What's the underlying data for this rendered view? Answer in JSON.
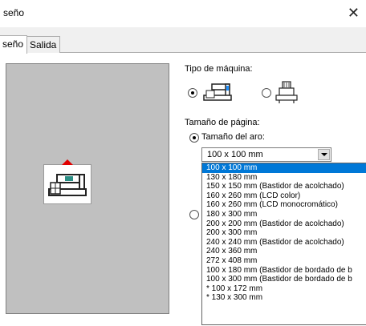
{
  "window": {
    "title": "seño",
    "close_glyph": "✕"
  },
  "tabs": [
    {
      "label": "seño",
      "active": true
    },
    {
      "label": "Salida",
      "active": false
    }
  ],
  "machine": {
    "heading": "Tipo de máquina:",
    "options": [
      {
        "name": "single-needle-machine",
        "selected": true
      },
      {
        "name": "multi-needle-machine",
        "selected": false
      }
    ]
  },
  "page_size": {
    "heading": "Tamaño de página:",
    "hoop_option": {
      "label": "Tamaño del aro:",
      "selected": true
    },
    "second_option": {
      "selected": false
    },
    "combo_value": "100 x 100 mm",
    "dropdown_items": [
      "100 x 100 mm",
      "130 x 180 mm",
      "150 x 150 mm (Bastidor de acolchado)",
      "160 x 260 mm (LCD color)",
      "160 x 260 mm (LCD monocromático)",
      "180 x 300 mm",
      "200 x 200 mm (Bastidor de acolchado)",
      "200 x 300 mm",
      "240 x 240 mm (Bastidor de acolchado)",
      "240 x 360 mm",
      "272 x 408 mm",
      "100 x 180 mm (Bastidor de bordado de b",
      "100 x 300 mm (Bastidor de bordado de b",
      "* 100 x 172 mm",
      "* 130 x 300 mm"
    ],
    "selected_index": 0
  },
  "colors": {
    "selection": "#0078d7",
    "hoop_marker": "#e00000",
    "preview_bg": "#c0c0c0"
  }
}
